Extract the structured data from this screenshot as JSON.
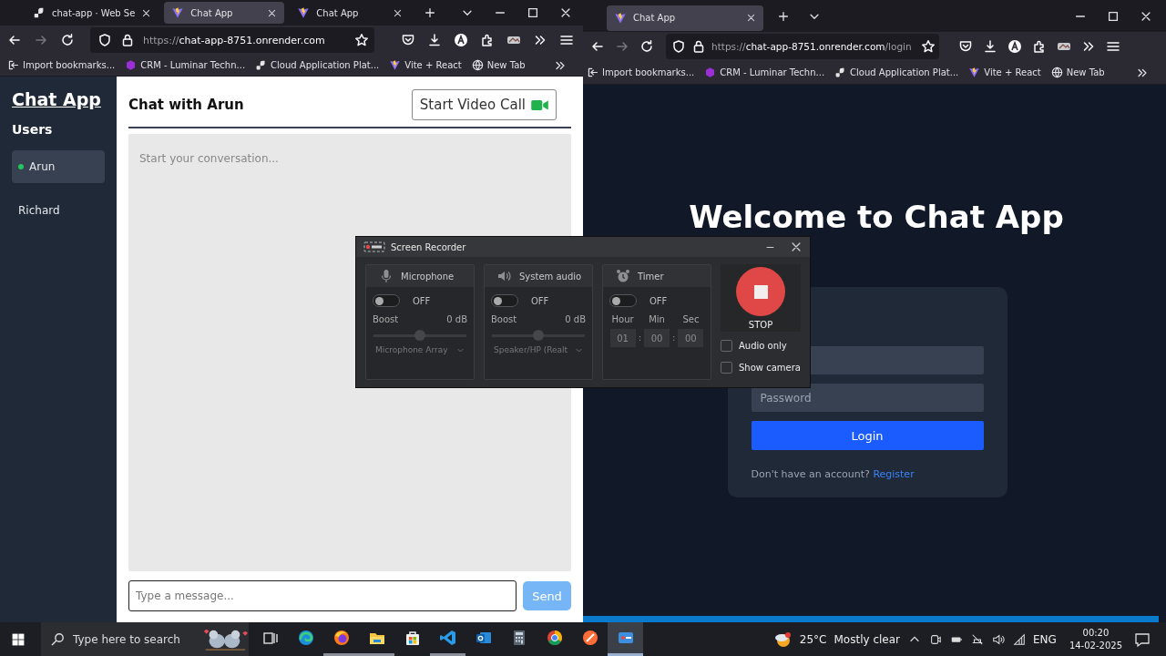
{
  "windows": [
    {
      "kind": "chat",
      "tabs": [
        {
          "title": "chat-app · Web Se",
          "selected": false
        },
        {
          "title": "Chat App",
          "selected": true
        },
        {
          "title": "Chat App",
          "selected": false
        }
      ],
      "address": {
        "scheme": "https://",
        "host": "chat-app-8751.onrender.com"
      },
      "bookmarks": [
        "Import bookmarks...",
        "CRM - Luminar Techn...",
        "Cloud Application Plat...",
        "Vite + React",
        "New Tab"
      ],
      "page": {
        "brand": "Chat App",
        "users_heading": "Users",
        "users": [
          {
            "name": "Arun",
            "selected": true,
            "online": true
          },
          {
            "name": "Richard",
            "selected": false,
            "online": false
          }
        ],
        "chat_title": "Chat with Arun",
        "video_call_button": "Start Video Call",
        "empty_state": "Start your conversation...",
        "message_placeholder": "Type a message...",
        "send_button": {
          "label": "Send",
          "disabled": true
        }
      }
    },
    {
      "kind": "login",
      "tabs": [
        {
          "title": "Chat App",
          "selected": true
        }
      ],
      "address": {
        "scheme": "https://",
        "host": "chat-app-8751.onrender.com",
        "path": "/login"
      },
      "bookmarks": [
        "Import bookmarks...",
        "CRM - Luminar Techn...",
        "Cloud Application Plat...",
        "Vite + React",
        "New Tab"
      ],
      "page": {
        "heading": "Welcome to Chat App",
        "password_placeholder": "Password",
        "login_button": "Login",
        "signup_prompt": "Don't have an account?",
        "signup_link": "Register"
      }
    }
  ],
  "recorder": {
    "title": "Screen Recorder",
    "panels": [
      {
        "kind": "audio",
        "title": "Microphone",
        "on": false,
        "state_label": "OFF",
        "boost_label": "Boost",
        "boost_value": "0 dB",
        "level": 0.5,
        "device": "Microphone Array",
        "disabled": true
      },
      {
        "kind": "audio",
        "title": "System audio",
        "on": false,
        "state_label": "OFF",
        "boost_label": "Boost",
        "boost_value": "0 dB",
        "level": 0.5,
        "device": "Speaker/HP (Realt",
        "disabled": true
      },
      {
        "kind": "timer",
        "title": "Timer",
        "on": false,
        "state_label": "OFF",
        "disabled": true,
        "units": [
          {
            "label": "Hour",
            "value": "01",
            "separator": ":"
          },
          {
            "label": "Min",
            "value": "00",
            "separator": ":"
          },
          {
            "label": "Sec",
            "value": "00"
          }
        ]
      }
    ],
    "stop_label": "STOP",
    "options": [
      {
        "label": "Audio only",
        "checked": false
      },
      {
        "label": "Show camera",
        "checked": false
      }
    ]
  },
  "taskbar": {
    "search_placeholder": "Type here to search",
    "apps": [
      {
        "running": false,
        "selected": false
      },
      {
        "running": false,
        "selected": false
      },
      {
        "running": true,
        "selected": false
      },
      {
        "running": true,
        "selected": false
      },
      {
        "running": false,
        "selected": false
      },
      {
        "running": true,
        "selected": false
      },
      {
        "running": false,
        "selected": false
      },
      {
        "running": false,
        "selected": false
      },
      {
        "running": false,
        "selected": false
      },
      {
        "running": false,
        "selected": false
      },
      {
        "running": true,
        "selected": true
      }
    ],
    "temperature": "25°C",
    "condition": "Mostly clear",
    "language": "ENG",
    "time": "00:20",
    "date": "14-02-2025"
  }
}
